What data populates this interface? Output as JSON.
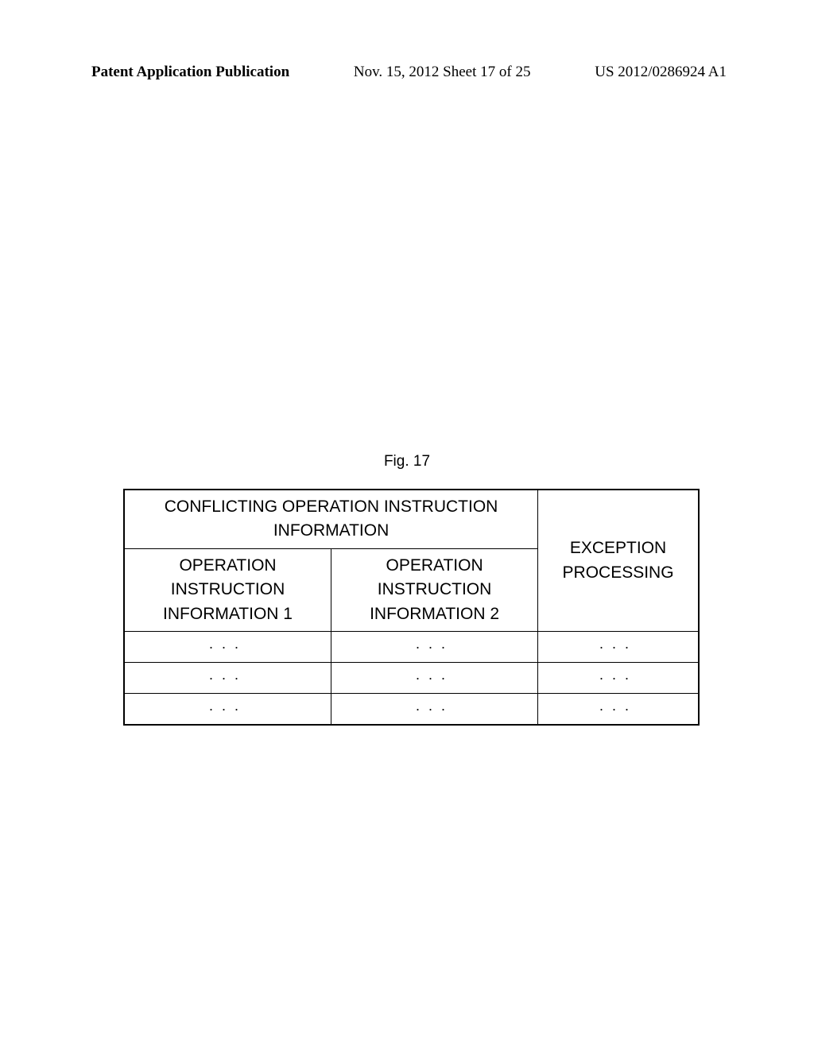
{
  "header": {
    "left": "Patent Application Publication",
    "center": "Nov. 15, 2012  Sheet 17 of 25",
    "right": "US 2012/0286924 A1"
  },
  "figure_label": "Fig. 17",
  "table": {
    "top_header": "CONFLICTING OPERATION INSTRUCTION INFORMATION",
    "sub_header_1": "OPERATION INSTRUCTION INFORMATION 1",
    "sub_header_2": "OPERATION INSTRUCTION INFORMATION 2",
    "right_header": "EXCEPTION PROCESSING",
    "rows": [
      {
        "c1": "···",
        "c2": "···",
        "c3": "···"
      },
      {
        "c1": "···",
        "c2": "···",
        "c3": "···"
      },
      {
        "c1": "···",
        "c2": "···",
        "c3": "···"
      }
    ]
  }
}
